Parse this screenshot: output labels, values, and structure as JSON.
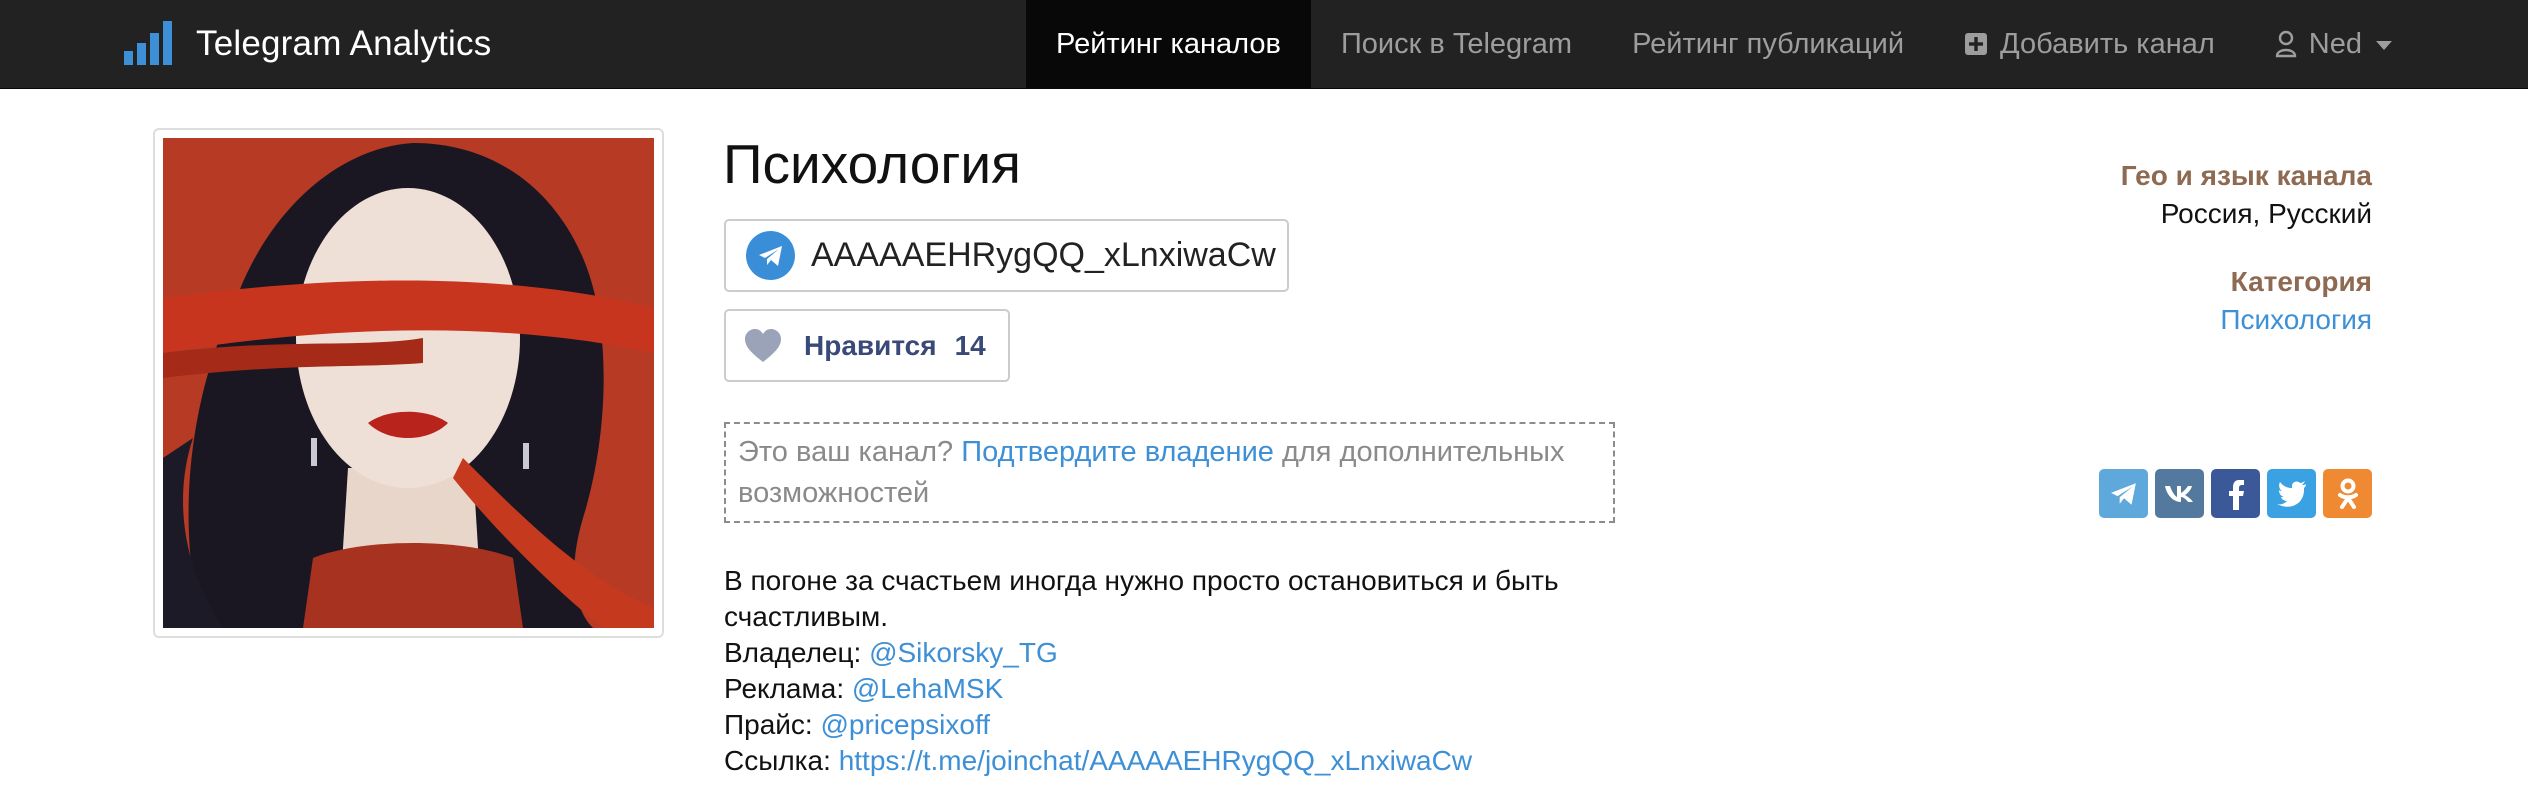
{
  "navbar": {
    "brand": "Telegram Analytics",
    "items": [
      {
        "label": "Рейтинг каналов",
        "active": true
      },
      {
        "label": "Поиск в Telegram",
        "active": false
      },
      {
        "label": "Рейтинг публикаций",
        "active": false
      },
      {
        "label": "Добавить канал",
        "icon": "plus-square-icon",
        "active": false
      },
      {
        "label": "Ned",
        "icon": "user-icon",
        "dropdown": true,
        "active": false
      }
    ]
  },
  "channel": {
    "title": "Психология",
    "username": "AAAAAEHRygQQ_xLnxiwaCw",
    "like_label": "Нравится",
    "like_count": "14",
    "claim": {
      "prefix": "Это ваш канал?",
      "link": "Подтвердите владение",
      "suffix": "для дополнительных возможностей"
    },
    "description": {
      "line1": "В погоне за счастьем иногда нужно просто остановиться и быть счастливым.",
      "owner_label": "Владелец:",
      "owner_value": "@Sikorsky_TG",
      "ads_label": "Реклама:",
      "ads_value": "@LehaMSK",
      "price_label": "Прайс:",
      "price_value": "@pricepsixoff",
      "link_label": "Ссылка:",
      "link_value": "https://t.me/joinchat/AAAAAEHRygQQ_xLnxiwaCw"
    }
  },
  "meta": {
    "geo_label": "Гео и язык канала",
    "geo_value": "Россия, Русский",
    "category_label": "Категория",
    "category_value": "Психология"
  },
  "share": [
    {
      "name": "telegram-share",
      "icon": "telegram-icon",
      "color": "#5fa8dc"
    },
    {
      "name": "vk-share",
      "icon": "vk-icon",
      "color": "#53799f"
    },
    {
      "name": "facebook-share",
      "icon": "facebook-icon",
      "color": "#3b5998"
    },
    {
      "name": "twitter-share",
      "icon": "twitter-icon",
      "color": "#3aa1e3"
    },
    {
      "name": "odnoklassniki-share",
      "icon": "odnoklassniki-icon",
      "color": "#ef8a32"
    }
  ],
  "colors": {
    "navbar_bg": "#222222",
    "nav_active_bg": "#080808",
    "link": "#3d8fd6",
    "meta_label": "#8f6a52",
    "avatar_background": "#b63a24"
  }
}
